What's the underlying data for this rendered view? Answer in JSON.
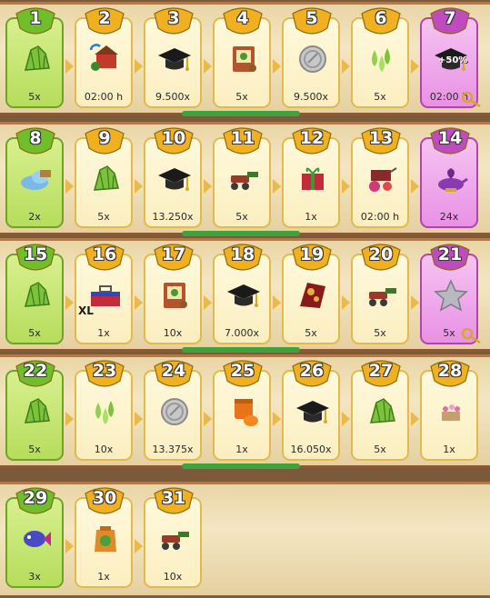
{
  "colors": {
    "green": "#b6dd5c",
    "gold": "#e4b94b",
    "purple": "#e991e4"
  },
  "rows": [
    {
      "days": [
        {
          "num": "1",
          "label": "5x",
          "style": "green",
          "icon": "leaf-bundle-icon"
        },
        {
          "num": "2",
          "label": "02:00 h",
          "style": "gold",
          "icon": "farm-boost-icon"
        },
        {
          "num": "3",
          "label": "9.500x",
          "style": "gold",
          "icon": "graduation-cap-icon"
        },
        {
          "num": "4",
          "label": "5x",
          "style": "gold",
          "icon": "seed-packet-icon"
        },
        {
          "num": "5",
          "label": "9.500x",
          "style": "gold",
          "icon": "coin-icon"
        },
        {
          "num": "6",
          "label": "5x",
          "style": "gold",
          "icon": "water-drops-icon"
        },
        {
          "num": "7",
          "label": "02:00 h",
          "style": "purple",
          "icon": "graduation-cap-icon",
          "extra": "+50%",
          "key": true
        }
      ]
    },
    {
      "days": [
        {
          "num": "8",
          "label": "2x",
          "style": "green",
          "icon": "cloud-icon"
        },
        {
          "num": "9",
          "label": "5x",
          "style": "gold",
          "icon": "leaf-bundle-icon"
        },
        {
          "num": "10",
          "label": "13.250x",
          "style": "gold",
          "icon": "graduation-cap-icon"
        },
        {
          "num": "11",
          "label": "5x",
          "style": "gold",
          "icon": "sprayer-icon"
        },
        {
          "num": "12",
          "label": "1x",
          "style": "gold",
          "icon": "gift-icon"
        },
        {
          "num": "13",
          "label": "02:00 h",
          "style": "gold",
          "icon": "fruit-machine-icon"
        },
        {
          "num": "14",
          "label": "24x",
          "style": "purple",
          "icon": "genie-lamp-icon"
        }
      ]
    },
    {
      "days": [
        {
          "num": "15",
          "label": "5x",
          "style": "green",
          "icon": "leaf-bundle-icon"
        },
        {
          "num": "16",
          "label": "1x",
          "style": "gold",
          "icon": "toolbox-icon",
          "extra": "XL"
        },
        {
          "num": "17",
          "label": "10x",
          "style": "gold",
          "icon": "seed-packet-icon"
        },
        {
          "num": "18",
          "label": "7.000x",
          "style": "gold",
          "icon": "graduation-cap-icon"
        },
        {
          "num": "19",
          "label": "5x",
          "style": "gold",
          "icon": "decoration-icon"
        },
        {
          "num": "20",
          "label": "5x",
          "style": "gold",
          "icon": "sprayer-icon"
        },
        {
          "num": "21",
          "label": "5x",
          "style": "purple",
          "icon": "star-icon",
          "key": true
        }
      ]
    },
    {
      "days": [
        {
          "num": "22",
          "label": "5x",
          "style": "green",
          "icon": "leaf-bundle-icon"
        },
        {
          "num": "23",
          "label": "10x",
          "style": "gold",
          "icon": "water-drops-icon"
        },
        {
          "num": "24",
          "label": "13.375x",
          "style": "gold",
          "icon": "coin-icon"
        },
        {
          "num": "25",
          "label": "1x",
          "style": "gold",
          "icon": "pumpkin-jar-icon"
        },
        {
          "num": "26",
          "label": "16.050x",
          "style": "gold",
          "icon": "graduation-cap-icon"
        },
        {
          "num": "27",
          "label": "5x",
          "style": "gold",
          "icon": "leaf-bundle-icon"
        },
        {
          "num": "28",
          "label": "1x",
          "style": "gold",
          "icon": "flower-box-icon"
        }
      ]
    },
    {
      "days": [
        {
          "num": "29",
          "label": "3x",
          "style": "green",
          "icon": "fish-icon"
        },
        {
          "num": "30",
          "label": "1x",
          "style": "gold",
          "icon": "seed-bag-icon"
        },
        {
          "num": "31",
          "label": "10x",
          "style": "gold",
          "icon": "sprayer-icon"
        }
      ]
    }
  ]
}
